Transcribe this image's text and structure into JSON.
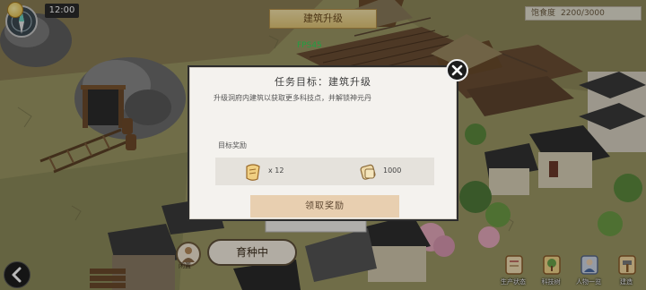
{
  "hud": {
    "time": "12:00",
    "banner_label": "建筑升级",
    "fps_label": "FPS45",
    "satiety_label": "饱食度",
    "satiety_value": "2200/3000",
    "breeding_button_label": "育种中",
    "worker_label": "闲置"
  },
  "bottom_menu": {
    "items": [
      {
        "label": "生产状态",
        "icon": "scroll-icon"
      },
      {
        "label": "科技树",
        "icon": "tree-icon"
      },
      {
        "label": "人物一览",
        "icon": "person-icon"
      },
      {
        "label": "建造",
        "icon": "hammer-icon"
      }
    ]
  },
  "dialog": {
    "title": "任务目标：建筑升级",
    "description": "升级洞府内建筑以获取更多科技点，并解锁神元丹",
    "reward_heading": "目标奖励",
    "rewards": [
      {
        "icon": "scroll-reward-icon",
        "value": "x 12"
      },
      {
        "icon": "gold-ingot-icon",
        "value": "1000"
      }
    ],
    "claim_label": "领取奖励"
  },
  "colors": {
    "dialog_bg": "#f4f2ee",
    "claim_button": "#e8cfb0",
    "banner": "#eed8a0",
    "fps_text": "#2fdc5a"
  }
}
